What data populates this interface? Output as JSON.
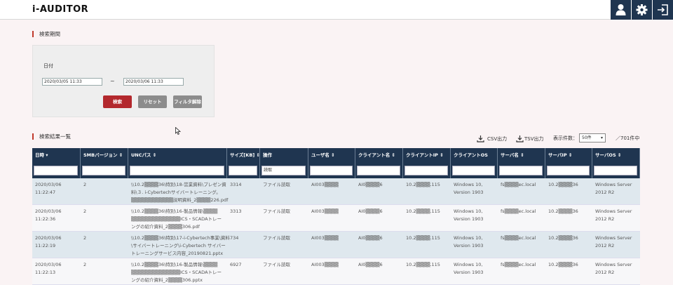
{
  "app": {
    "logo": "i-AUDITOR"
  },
  "header": {
    "icons": [
      "user-icon",
      "gear-icon",
      "logout-icon"
    ]
  },
  "filter": {
    "section_title": "検索期間",
    "date_label": "日付",
    "date_from": "2020/03/05 11:33",
    "date_to": "2020/03/06 11:33",
    "separator": "~",
    "search_button": "検索",
    "reset_button": "リセット",
    "clear_filter_button": "フィルタ解除"
  },
  "results": {
    "section_title": "検索結果一覧",
    "csv_label": "CSV出力",
    "tsv_label": "TSV出力",
    "page_size_label": "表示件数：",
    "page_size_value": "50件",
    "total_label": "／701件中"
  },
  "table": {
    "columns": [
      {
        "label": "日時",
        "filter": ""
      },
      {
        "label": "SMBバージョン",
        "filter": ""
      },
      {
        "label": "UNCパス",
        "filter": ""
      },
      {
        "label": "サイズ[KB]",
        "filter": ""
      },
      {
        "label": "操作",
        "filter": "読取"
      },
      {
        "label": "ユーザ名",
        "filter": ""
      },
      {
        "label": "クライアント名",
        "filter": ""
      },
      {
        "label": "クライアントIP",
        "filter": ""
      },
      {
        "label": "クライアントOS",
        "filter": ""
      },
      {
        "label": "サーバ名",
        "filter": ""
      },
      {
        "label": "サーバIP",
        "filter": ""
      },
      {
        "label": "サーバOS",
        "filter": ""
      }
    ],
    "rows": [
      {
        "date": "2020/03/06",
        "time": "11:22:47",
        "smb": "2",
        "unc1": "\\\\10.2▒▒▒▒36\\特別\\18-営業資料\\プレゼン資",
        "unc2": "料\\３. i-Cybertechサイバートレーニング。",
        "unc3": "▒▒▒▒▒▒▒▒▒▒▒▒説明資料_2▒▒▒▒226.pdf",
        "size": "3314",
        "op": "ファイル読取",
        "user": "AI003▒▒▒▒",
        "client": "AI0▒▒▒▒6",
        "ip": "10.2▒▒▒▒.115",
        "os1": "Windows 10,",
        "os2": "Version 1903",
        "server": "fs▒▒▒▒ec.local",
        "server_ip": "10.2▒▒▒▒36",
        "sos1": "Windows Server",
        "sos2": "2012 R2"
      },
      {
        "date": "2020/03/06",
        "time": "11:22:36",
        "smb": "2",
        "unc1": "\\\\10.2▒▒▒▒36\\特別\\16-製品情報\\▒▒▒▒",
        "unc2": "▒▒▒▒▒▒▒▒▒▒▒▒▒▒ICS・SCADAトレー",
        "unc3": "ングの紹介資料_2▒▒▒▒306.pdf",
        "size": "3313",
        "op": "ファイル読取",
        "user": "AI003▒▒▒▒",
        "client": "AI0▒▒▒▒6",
        "ip": "10.2▒▒▒▒.115",
        "os1": "Windows 10,",
        "os2": "Version 1903",
        "server": "fs▒▒▒▒ec.local",
        "server_ip": "10.2▒▒▒▒36",
        "sos1": "Windows Server",
        "sos2": "2012 R2"
      },
      {
        "date": "2020/03/06",
        "time": "11:22:19",
        "smb": "2",
        "unc1": "\\\\10.2▒▒▒▒36\\特別\\17-i-Cybertech事業\\資料",
        "unc2": "\\サイバートレーニング\\i-Cybertech サイバー",
        "unc3": "トレーニングサービス内容_20190821.pptx",
        "size": "734",
        "op": "ファイル読取",
        "user": "AI003▒▒▒▒",
        "client": "AI0▒▒▒▒6",
        "ip": "10.2▒▒▒▒.115",
        "os1": "Windows 10,",
        "os2": "Version 1903",
        "server": "fs▒▒▒▒ec.local",
        "server_ip": "10.2▒▒▒▒36",
        "sos1": "Windows Server",
        "sos2": "2012 R2"
      },
      {
        "date": "2020/03/06",
        "time": "11:22:13",
        "smb": "2",
        "unc1": "\\\\10.2▒▒▒▒36\\特別\\16-製品情報\\▒▒▒▒",
        "unc2": "▒▒▒▒▒▒▒▒▒▒▒▒▒▒ICS・SCADAトレー",
        "unc3": "ングの紹介資料_2▒▒▒▒306.pptx",
        "size": "6927",
        "op": "ファイル読取",
        "user": "AI003▒▒▒▒",
        "client": "AI0▒▒▒▒6",
        "ip": "10.2▒▒▒▒.115",
        "os1": "Windows 10,",
        "os2": "Version 1903",
        "server": "fs▒▒▒▒ec.local",
        "server_ip": "10.2▒▒▒▒36",
        "sos1": "Windows Server",
        "sos2": "2012 R2"
      }
    ]
  },
  "colors": {
    "navy": "#1f3550",
    "accent_red": "#b3282d",
    "row_alt": "#dfe8ee",
    "button_gray": "#8c8c8c"
  }
}
